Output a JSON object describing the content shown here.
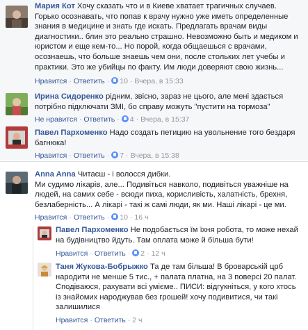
{
  "comments": [
    {
      "author": "Мария Кот",
      "lines": [
        "Хочу сказать что и в Киеве хватает трагичных случаев.",
        "Горько осознавать, что попав к врачу нужно уже иметь определенные",
        "знания в медицине и знать где искать. Предлагать врачам виды",
        "диагностики.. блин это реально страшно. Невозможно быть и медиком и",
        "юристом и еще кем-то... Но порой, когда общаешься с врачами,",
        "осознаешь, что больше знаешь чем они, после стольких лет учебы и",
        "практики. Это же убийцы по факту. Им люди доверяют свою жизнь..."
      ],
      "reply": "Нравится",
      "respond": "Ответить",
      "likes": "10",
      "time": "Вчера, в 15:33"
    },
    {
      "author": "Ирина Сидоренко",
      "lines": [
        "рідним, звісно, зараз не цього, але мені здається",
        "потрібно підключати ЗМІ, бо справу можуть \"пустити на тормоза\""
      ],
      "reply": "Не нравится",
      "respond": "Ответить",
      "likes": "4",
      "time": "Вчера, в 15:37"
    },
    {
      "author": "Павел Пархоменко",
      "lines": [
        "Надо создать петицию на увольнение того бездаря",
        "багнюка!"
      ],
      "reply": "Нравится",
      "respond": "Ответить",
      "likes": "7",
      "time": "Вчера, в 15:38"
    },
    {
      "author": "Anna Anna",
      "lines": [
        "Читаєш - і волосся дибки.",
        "Ми судимо лікарів, але... Подивіться навколо, подивіться уважніше на",
        "людей, на самих себе - всюди пиха, корисливість, халатність, брехня,",
        "безлаберність... А лікарі - такі ж самі люди, як ми. Наші лікарі - це ми."
      ],
      "reply": "Нравится",
      "respond": "Ответить",
      "likes": "10",
      "time": "16 ч"
    },
    {
      "author": "Павел Пархоменко",
      "lines": [
        "Не подобається їм їхня робота, то може нехай",
        "на будівництво йдуть. Там оплата може й більша бути!"
      ],
      "reply": "Нравится",
      "respond": "Ответить",
      "likes": "2",
      "time": "12 ч"
    },
    {
      "author": "Таня Жукова-Бобрыжко",
      "lines": [
        "Та де там більша! В броварській црб",
        "народити не менше 5 тис., + палата платна, на 3 поверсі 20 палат.",
        "Сподіваюся, рахувати всі умієме.. ПИСИ: відгукніться, у кого хтось",
        "із знайомих народжував без грошей! хочу подивитися, чи такі",
        "залишилися"
      ],
      "reply": "Нравится",
      "respond": "Ответить",
      "likes": "",
      "time": "2 ч"
    }
  ]
}
